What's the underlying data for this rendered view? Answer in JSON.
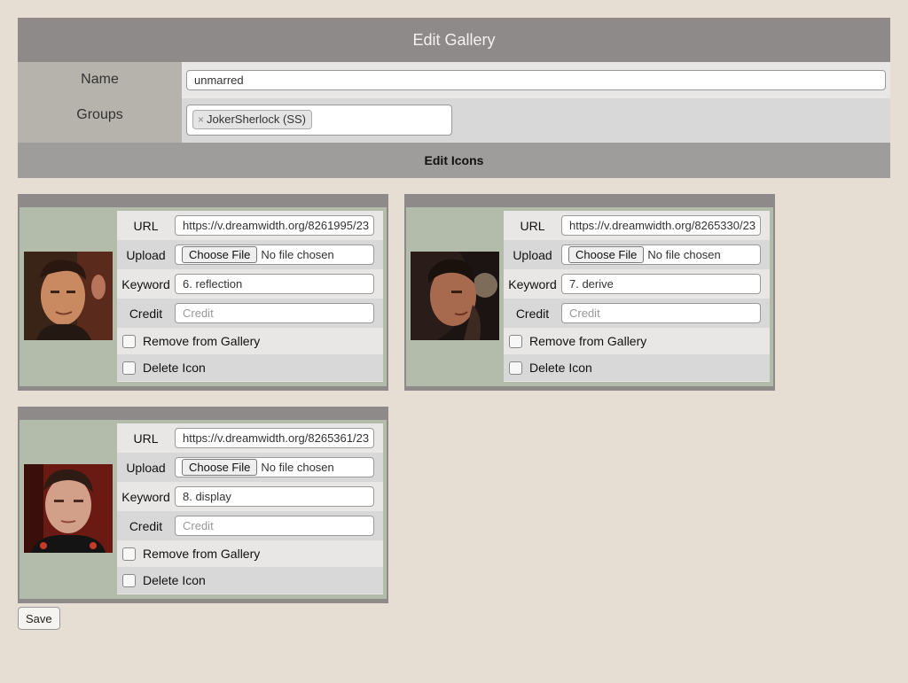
{
  "page": {
    "title": "Edit Gallery"
  },
  "form": {
    "name_label": "Name",
    "name_value": "unmarred",
    "groups_label": "Groups",
    "groups": [
      {
        "label": "JokerSherlock (SS)",
        "remove_glyph": "×"
      }
    ]
  },
  "edit_icons": {
    "header": "Edit Icons",
    "labels": {
      "url": "URL",
      "upload": "Upload",
      "keyword": "Keyword",
      "credit": "Credit",
      "choose_file": "Choose File",
      "no_file": "No file chosen",
      "credit_placeholder": "Credit",
      "remove": "Remove from Gallery",
      "delete": "Delete Icon"
    },
    "icons": [
      {
        "url": "https://v.dreamwidth.org/8261995/23",
        "keyword": "6. reflection",
        "credit": "",
        "remove_checked": false,
        "delete_checked": false
      },
      {
        "url": "https://v.dreamwidth.org/8265330/23",
        "keyword": "7. derive",
        "credit": "",
        "remove_checked": false,
        "delete_checked": false
      },
      {
        "url": "https://v.dreamwidth.org/8265361/23",
        "keyword": "8. display",
        "credit": "",
        "remove_checked": false,
        "delete_checked": false
      }
    ]
  },
  "actions": {
    "save_label": "Save"
  },
  "colors": {
    "page_bg": "#e6ded2",
    "header_bg": "#8e8a8a",
    "label_bg": "#b5b3ab",
    "card_bg": "#b3bcab",
    "section_header_bg": "#9e9d9b"
  }
}
